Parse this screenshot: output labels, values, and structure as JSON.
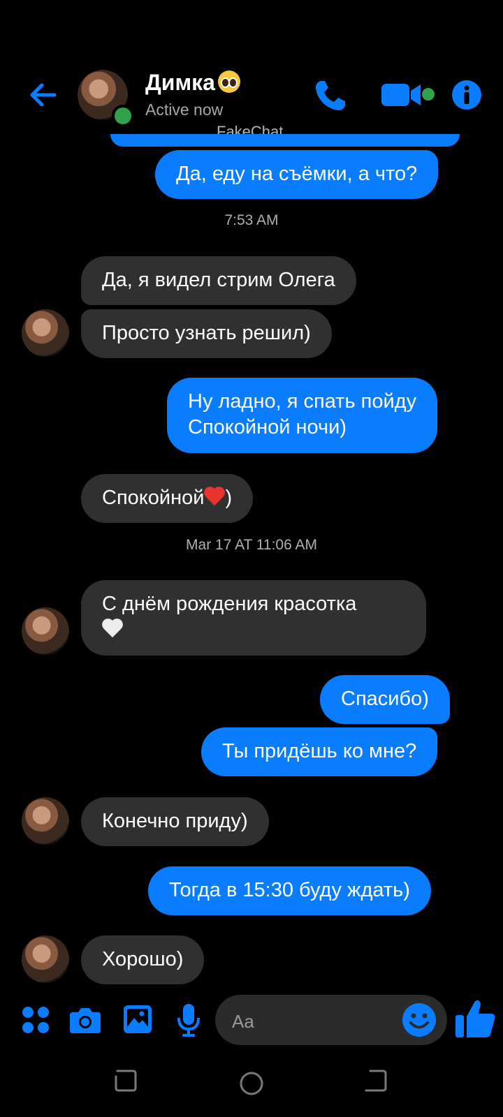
{
  "header": {
    "contact_name": "Димка",
    "status": "Active now",
    "watermark": "FakeChat",
    "back_icon": "arrow-left-icon",
    "phone_icon": "phone-icon",
    "video_icon": "video-camera-icon",
    "info_icon": "info-icon"
  },
  "messages": {
    "m1": "Да, еду на съёмки, а что?",
    "ts1": "7:53 AM",
    "m2": "Да, я видел стрим Олега",
    "m3": "Просто узнать решил)",
    "m4_line1": "Ну ладно, я спать пойду",
    "m4_line2": "Спокойной ночи)",
    "m5_text": "Спокойной",
    "m5_tail": ")",
    "ts2": "Mar 17 AT 11:06 AM",
    "m6_line1": "С днём рождения красотка",
    "m7": "Спасибо)",
    "m8": "Ты придёшь ко мне?",
    "m9": "Конечно приду)",
    "m10": "Тогда в 15:30 буду ждать)",
    "m11": "Хорошо)"
  },
  "composer": {
    "placeholder": "Aa",
    "icons": [
      "apps-icon",
      "camera-icon",
      "gallery-icon",
      "microphone-icon",
      "emoji-icon",
      "thumbs-up-icon"
    ]
  },
  "colors": {
    "accent": "#0a7cff",
    "incoming_bubble": "#303030",
    "online": "#31a24c",
    "background": "#000000"
  }
}
